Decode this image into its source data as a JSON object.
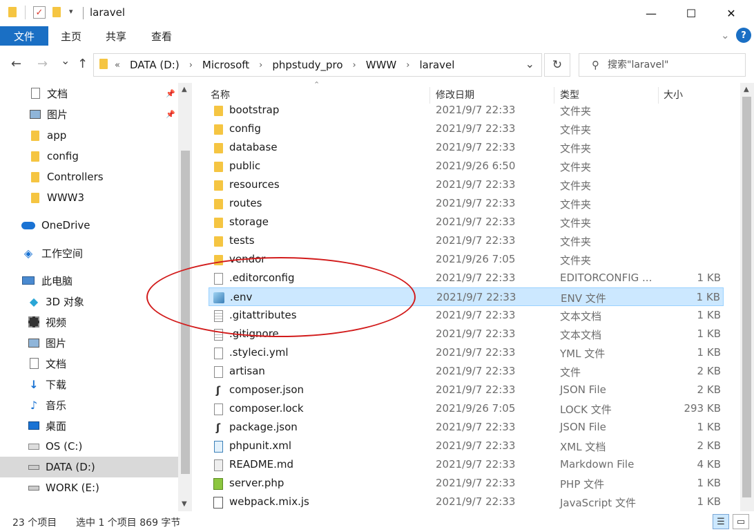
{
  "window": {
    "title": "laravel",
    "controls": {
      "minimize": "—",
      "maximize": "☐",
      "close": "✕"
    }
  },
  "ribbon": {
    "tabs": [
      "文件",
      "主页",
      "共享",
      "查看"
    ],
    "expand_icon": "chevron-down-icon",
    "help": "?"
  },
  "nav": {
    "back": "←",
    "forward": "→",
    "recent": "⌄",
    "up": "↑",
    "breadcrumb_prefix": "«",
    "breadcrumb": [
      "DATA (D:)",
      "Microsoft",
      "phpstudy_pro",
      "WWW",
      "laravel"
    ],
    "dropdown": "⌄",
    "refresh": "↻",
    "search_placeholder": "搜索\"laravel\""
  },
  "sidebar": {
    "items": [
      {
        "label": "文档",
        "icon": "document-icon",
        "pinned": true
      },
      {
        "label": "图片",
        "icon": "picture-icon",
        "pinned": true
      },
      {
        "label": "app",
        "icon": "folder-icon",
        "pinned": false
      },
      {
        "label": "config",
        "icon": "folder-icon",
        "pinned": false
      },
      {
        "label": "Controllers",
        "icon": "folder-icon",
        "pinned": false
      },
      {
        "label": "WWW3",
        "icon": "folder-icon",
        "pinned": false
      },
      {
        "label": "OneDrive",
        "icon": "cloud-icon",
        "pinned": false
      },
      {
        "label": "工作空间",
        "icon": "workspace-icon",
        "pinned": false
      },
      {
        "label": "此电脑",
        "icon": "computer-icon",
        "pinned": false
      },
      {
        "label": "3D 对象",
        "icon": "3d-objects-icon",
        "pinned": false
      },
      {
        "label": "视频",
        "icon": "video-icon",
        "pinned": false
      },
      {
        "label": "图片",
        "icon": "picture-icon",
        "pinned": false
      },
      {
        "label": "文档",
        "icon": "document-icon",
        "pinned": false
      },
      {
        "label": "下载",
        "icon": "download-icon",
        "pinned": false
      },
      {
        "label": "音乐",
        "icon": "music-icon",
        "pinned": false
      },
      {
        "label": "桌面",
        "icon": "desktop-icon",
        "pinned": false
      },
      {
        "label": "OS (C:)",
        "icon": "os-drive-icon",
        "pinned": false
      },
      {
        "label": "DATA (D:)",
        "icon": "drive-icon",
        "pinned": false,
        "selected": true
      },
      {
        "label": "WORK (E:)",
        "icon": "drive-icon",
        "pinned": false
      }
    ]
  },
  "columns": {
    "name": "名称",
    "modified": "修改日期",
    "type": "类型",
    "size": "大小"
  },
  "files": [
    {
      "name": "bootstrap",
      "date": "2021/9/7 22:33",
      "type": "文件夹",
      "size": "",
      "icon": "folder-icon"
    },
    {
      "name": "config",
      "date": "2021/9/7 22:33",
      "type": "文件夹",
      "size": "",
      "icon": "folder-icon"
    },
    {
      "name": "database",
      "date": "2021/9/7 22:33",
      "type": "文件夹",
      "size": "",
      "icon": "folder-icon"
    },
    {
      "name": "public",
      "date": "2021/9/26 6:50",
      "type": "文件夹",
      "size": "",
      "icon": "folder-icon"
    },
    {
      "name": "resources",
      "date": "2021/9/7 22:33",
      "type": "文件夹",
      "size": "",
      "icon": "folder-icon"
    },
    {
      "name": "routes",
      "date": "2021/9/7 22:33",
      "type": "文件夹",
      "size": "",
      "icon": "folder-icon"
    },
    {
      "name": "storage",
      "date": "2021/9/7 22:33",
      "type": "文件夹",
      "size": "",
      "icon": "folder-icon"
    },
    {
      "name": "tests",
      "date": "2021/9/7 22:33",
      "type": "文件夹",
      "size": "",
      "icon": "folder-icon"
    },
    {
      "name": "vendor",
      "date": "2021/9/26 7:05",
      "type": "文件夹",
      "size": "",
      "icon": "folder-icon"
    },
    {
      "name": ".editorconfig",
      "date": "2021/9/7 22:33",
      "type": "EDITORCONFIG ...",
      "size": "1 KB",
      "icon": "file-icon"
    },
    {
      "name": ".env",
      "date": "2021/9/7 22:33",
      "type": "ENV 文件",
      "size": "1 KB",
      "icon": "env-file-icon",
      "selected": true
    },
    {
      "name": ".gitattributes",
      "date": "2021/9/7 22:33",
      "type": "文本文档",
      "size": "1 KB",
      "icon": "text-file-icon"
    },
    {
      "name": ".gitignore",
      "date": "2021/9/7 22:33",
      "type": "文本文档",
      "size": "1 KB",
      "icon": "text-file-icon"
    },
    {
      "name": ".styleci.yml",
      "date": "2021/9/7 22:33",
      "type": "YML 文件",
      "size": "1 KB",
      "icon": "file-icon"
    },
    {
      "name": "artisan",
      "date": "2021/9/7 22:33",
      "type": "文件",
      "size": "2 KB",
      "icon": "file-icon"
    },
    {
      "name": "composer.json",
      "date": "2021/9/7 22:33",
      "type": "JSON File",
      "size": "2 KB",
      "icon": "json-file-icon"
    },
    {
      "name": "composer.lock",
      "date": "2021/9/26 7:05",
      "type": "LOCK 文件",
      "size": "293 KB",
      "icon": "file-icon"
    },
    {
      "name": "package.json",
      "date": "2021/9/7 22:33",
      "type": "JSON File",
      "size": "1 KB",
      "icon": "json-file-icon"
    },
    {
      "name": "phpunit.xml",
      "date": "2021/9/7 22:33",
      "type": "XML 文档",
      "size": "2 KB",
      "icon": "xml-file-icon"
    },
    {
      "name": "README.md",
      "date": "2021/9/7 22:33",
      "type": "Markdown File",
      "size": "4 KB",
      "icon": "markdown-file-icon"
    },
    {
      "name": "server.php",
      "date": "2021/9/7 22:33",
      "type": "PHP 文件",
      "size": "1 KB",
      "icon": "php-file-icon"
    },
    {
      "name": "webpack.mix.js",
      "date": "2021/9/7 22:33",
      "type": "JavaScript 文件",
      "size": "1 KB",
      "icon": "js-file-icon"
    }
  ],
  "status": {
    "count": "23 个项目",
    "selection": "选中 1 个项目  869 字节"
  },
  "colors": {
    "accent": "#1a6fc4",
    "selection_bg": "#cce8ff",
    "selection_border": "#99d1ff",
    "annotation": "#d21b1b",
    "folder": "#f5c542"
  }
}
